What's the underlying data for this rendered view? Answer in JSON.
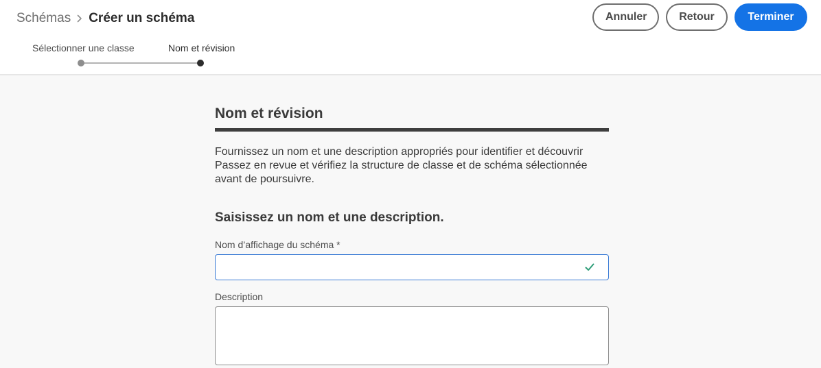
{
  "header": {
    "breadcrumb": {
      "parent": "Schémas",
      "current": "Créer un schéma"
    },
    "actions": {
      "cancel_label": "Annuler",
      "back_label": "Retour",
      "finish_label": "Terminer"
    },
    "stepper": {
      "steps": [
        {
          "label": "Sélectionner une classe",
          "state": "completed"
        },
        {
          "label": "Nom et révision",
          "state": "current"
        }
      ]
    }
  },
  "main": {
    "section_title": "Nom et révision",
    "intro_lines": [
      "Fournissez un nom et une description appropriés pour identifier et découvrir",
      "Passez en revue et vérifiez la structure de classe et de schéma sélectionnée",
      "avant de poursuivre."
    ],
    "form_title": "Saisissez un nom et une description.",
    "name_field": {
      "label": "Nom d’affichage du schéma *",
      "value": "",
      "status_icon": "checkmark-icon"
    },
    "description_field": {
      "label": "Description",
      "value": ""
    }
  },
  "colors": {
    "primary": "#1473e6",
    "valid": "#2d9d78",
    "focus_border": "#3a7bd5"
  }
}
